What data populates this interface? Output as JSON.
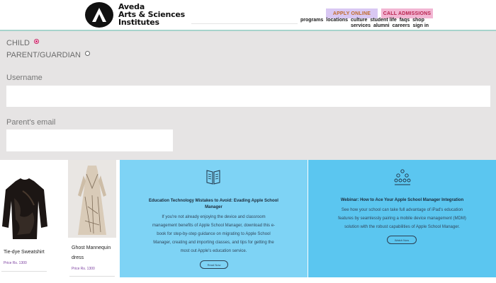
{
  "header": {
    "brand_lines": [
      "Aveda",
      "Arts & Sciences",
      "Institutes"
    ],
    "apply_label": "APPLY ONLINE",
    "call_label": "CALL ADMISSIONS",
    "nav_row1": [
      "programs",
      "locations",
      "culture",
      "student life",
      "faqs",
      "shop"
    ],
    "nav_row2": [
      "services",
      "alumni",
      "careers",
      "sign in"
    ]
  },
  "form": {
    "radio_child": "CHILD",
    "radio_parent": "PARENT/GUARDIAN",
    "username_label": "Username",
    "username_value": "",
    "parent_email_label": "Parent's email",
    "parent_email_value": ""
  },
  "products": [
    {
      "name": "Tie-dye Sweatshirt",
      "price": "Price Rs. 1300"
    },
    {
      "name_line1": "Ghost Mannequin",
      "name_line2": "dress",
      "price": "Price Rs. 1300"
    }
  ],
  "promos": [
    {
      "title_line1": "Education Technology Mistakes to Avoid: Evading Apple School",
      "title_line2": "Manager",
      "body": [
        "If you're not already enjoying the device and classroom",
        "management benefits of Apple School Manager, download this e-",
        "book for step-by-step guidance on migrating to Apple School",
        "Manager, creating and importing classes, and tips for getting the",
        "most out Apple's education service."
      ],
      "cta": "Read Now",
      "bg": "#7ed3f5",
      "icon": "book-icon"
    },
    {
      "title": "Webinar: How to Ace Your Apple School Manager Integration",
      "body": [
        "See how your school can take full advantage of iPad's education",
        "features by seamlessly pairing a mobile device management (MDM)",
        "solution with the robust capabilities of Apple School Manager."
      ],
      "cta": "Watch Now",
      "bg": "#5bc6f0",
      "icon": "people-group-icon"
    }
  ]
}
